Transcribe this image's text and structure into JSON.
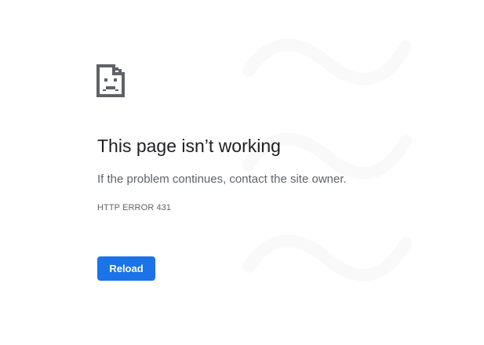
{
  "title": "This page isn’t working",
  "message": "If the problem continues, contact the site owner.",
  "error_code": "HTTP ERROR 431",
  "reload_label": "Reload",
  "colors": {
    "background": "#ffffff",
    "text_primary": "#202124",
    "text_secondary": "#5f6368",
    "accent": "#1a73e8"
  },
  "icons": {
    "error_icon": "sad-page-icon"
  }
}
